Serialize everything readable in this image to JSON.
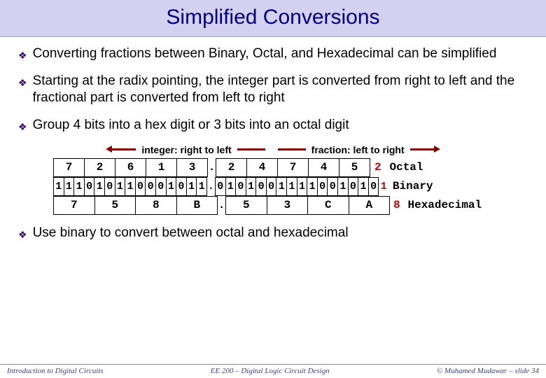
{
  "title": "Simplified Conversions",
  "bullets": {
    "b1": "Converting fractions between Binary, Octal, and Hexadecimal can be simplified",
    "b2": "Starting at the radix pointing, the integer part is converted from right to left and the fractional part is converted from left to right",
    "b3": "Group 4 bits into a hex digit or 3 bits into an octal digit",
    "b4": "Use binary to convert between octal and hexadecimal"
  },
  "arrows": {
    "left_label": "integer: right to left",
    "right_label": "fraction: left to right"
  },
  "rows": {
    "octal": {
      "int": [
        "7",
        "2",
        "6",
        "1",
        "3"
      ],
      "frac": [
        "2",
        "4",
        "7",
        "4",
        "5"
      ],
      "extra": "2",
      "label": "Octal"
    },
    "binary": {
      "int": [
        "1",
        "1",
        "1",
        "0",
        "1",
        "0",
        "1",
        "1",
        "0",
        "0",
        "0",
        "1",
        "0",
        "1",
        "1"
      ],
      "frac": [
        "0",
        "1",
        "0",
        "1",
        "0",
        "0",
        "1",
        "1",
        "1",
        "1",
        "0",
        "0",
        "1",
        "0",
        "1",
        "0"
      ],
      "extra": "1",
      "label": "Binary"
    },
    "hex": {
      "int": [
        "7",
        "5",
        "8",
        "B"
      ],
      "frac": [
        "5",
        "3",
        "C",
        "A"
      ],
      "extra": "8",
      "label": "Hexadecimal"
    }
  },
  "footer": {
    "left": "Introduction to Digital Circuits",
    "center": "EE 200 – Digital Logic Circuit Design",
    "right": "© Muhamed Mudawar – slide 34"
  }
}
